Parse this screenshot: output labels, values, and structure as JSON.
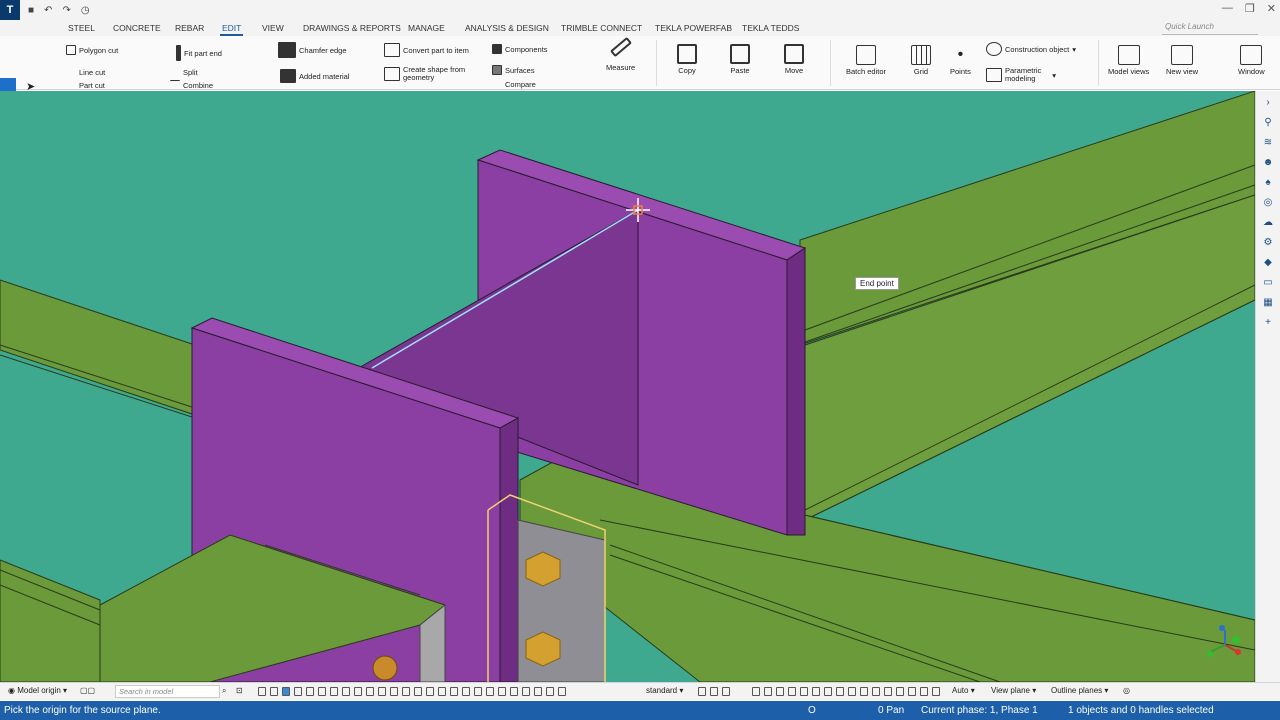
{
  "titlebar": {
    "logo": "T",
    "icons": [
      "save-icon",
      "undo-icon",
      "redo-icon",
      "history-icon"
    ]
  },
  "menu": {
    "tabs": [
      "STEEL",
      "CONCRETE",
      "REBAR",
      "EDIT",
      "VIEW",
      "DRAWINGS & REPORTS",
      "MANAGE",
      "ANALYSIS & DESIGN",
      "TRIMBLE CONNECT",
      "TEKLA POWERFAB",
      "TEKLA TEDDS"
    ],
    "active_tab": "EDIT",
    "quick_launch_placeholder": "Quick Launch"
  },
  "ribbon": {
    "polygon_cut": "Polygon cut",
    "line_cut": "Line cut",
    "part_cut": "Part cut",
    "fit_part_end": "Fit part end",
    "split": "Split",
    "combine": "Combine",
    "chamfer_edge": "Chamfer edge",
    "added_material": "Added material",
    "convert_part": "Convert part to item",
    "create_shape_1": "Create shape from",
    "create_shape_2": "geometry",
    "components": "Components",
    "surfaces": "Surfaces",
    "compare": "Compare",
    "measure": "Measure",
    "copy": "Copy",
    "paste": "Paste",
    "move": "Move",
    "batch_editor": "Batch editor",
    "grid": "Grid",
    "points": "Points",
    "construction_object": "Construction object",
    "parametric_1": "Parametric",
    "parametric_2": "modeling",
    "model_views": "Model views",
    "new_view": "New view",
    "window": "Window"
  },
  "viewport": {
    "tooltip": "End point"
  },
  "bottombar": {
    "model_origin": "Model origin",
    "search_placeholder": "Search in model",
    "standard": "standard",
    "auto": "Auto",
    "view_plane": "View plane",
    "outline_planes": "Outline planes"
  },
  "status": {
    "prompt": "Pick the origin for the source plane.",
    "o_indicator": "O",
    "pan": "0 Pan",
    "phase": "Current phase: 1, Phase 1",
    "selection": "1 objects and 0 handles selected"
  },
  "colors": {
    "viewport_bg": "#3fa98f",
    "beam_green": "#6a9a3a",
    "plate_purple": "#8c3fa3",
    "status_blue": "#1d5fa8"
  }
}
